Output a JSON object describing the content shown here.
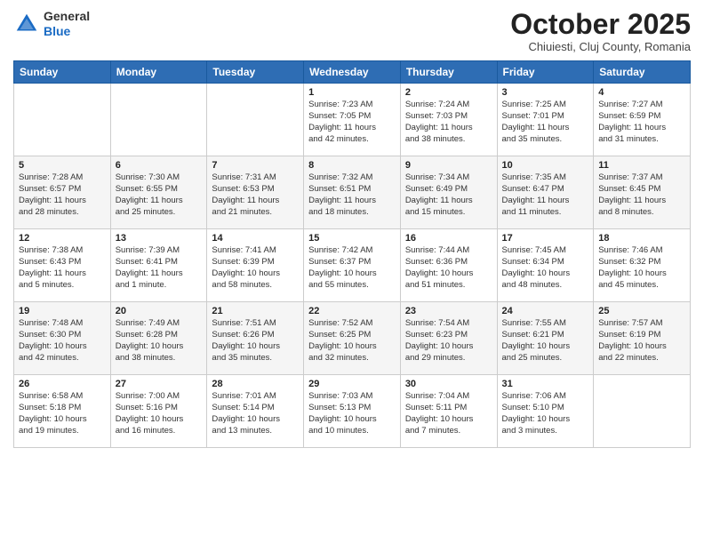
{
  "logo": {
    "general": "General",
    "blue": "Blue"
  },
  "title": "October 2025",
  "subtitle": "Chiuiesti, Cluj County, Romania",
  "days_header": [
    "Sunday",
    "Monday",
    "Tuesday",
    "Wednesday",
    "Thursday",
    "Friday",
    "Saturday"
  ],
  "weeks": [
    [
      {
        "day": "",
        "info": ""
      },
      {
        "day": "",
        "info": ""
      },
      {
        "day": "",
        "info": ""
      },
      {
        "day": "1",
        "info": "Sunrise: 7:23 AM\nSunset: 7:05 PM\nDaylight: 11 hours\nand 42 minutes."
      },
      {
        "day": "2",
        "info": "Sunrise: 7:24 AM\nSunset: 7:03 PM\nDaylight: 11 hours\nand 38 minutes."
      },
      {
        "day": "3",
        "info": "Sunrise: 7:25 AM\nSunset: 7:01 PM\nDaylight: 11 hours\nand 35 minutes."
      },
      {
        "day": "4",
        "info": "Sunrise: 7:27 AM\nSunset: 6:59 PM\nDaylight: 11 hours\nand 31 minutes."
      }
    ],
    [
      {
        "day": "5",
        "info": "Sunrise: 7:28 AM\nSunset: 6:57 PM\nDaylight: 11 hours\nand 28 minutes."
      },
      {
        "day": "6",
        "info": "Sunrise: 7:30 AM\nSunset: 6:55 PM\nDaylight: 11 hours\nand 25 minutes."
      },
      {
        "day": "7",
        "info": "Sunrise: 7:31 AM\nSunset: 6:53 PM\nDaylight: 11 hours\nand 21 minutes."
      },
      {
        "day": "8",
        "info": "Sunrise: 7:32 AM\nSunset: 6:51 PM\nDaylight: 11 hours\nand 18 minutes."
      },
      {
        "day": "9",
        "info": "Sunrise: 7:34 AM\nSunset: 6:49 PM\nDaylight: 11 hours\nand 15 minutes."
      },
      {
        "day": "10",
        "info": "Sunrise: 7:35 AM\nSunset: 6:47 PM\nDaylight: 11 hours\nand 11 minutes."
      },
      {
        "day": "11",
        "info": "Sunrise: 7:37 AM\nSunset: 6:45 PM\nDaylight: 11 hours\nand 8 minutes."
      }
    ],
    [
      {
        "day": "12",
        "info": "Sunrise: 7:38 AM\nSunset: 6:43 PM\nDaylight: 11 hours\nand 5 minutes."
      },
      {
        "day": "13",
        "info": "Sunrise: 7:39 AM\nSunset: 6:41 PM\nDaylight: 11 hours\nand 1 minute."
      },
      {
        "day": "14",
        "info": "Sunrise: 7:41 AM\nSunset: 6:39 PM\nDaylight: 10 hours\nand 58 minutes."
      },
      {
        "day": "15",
        "info": "Sunrise: 7:42 AM\nSunset: 6:37 PM\nDaylight: 10 hours\nand 55 minutes."
      },
      {
        "day": "16",
        "info": "Sunrise: 7:44 AM\nSunset: 6:36 PM\nDaylight: 10 hours\nand 51 minutes."
      },
      {
        "day": "17",
        "info": "Sunrise: 7:45 AM\nSunset: 6:34 PM\nDaylight: 10 hours\nand 48 minutes."
      },
      {
        "day": "18",
        "info": "Sunrise: 7:46 AM\nSunset: 6:32 PM\nDaylight: 10 hours\nand 45 minutes."
      }
    ],
    [
      {
        "day": "19",
        "info": "Sunrise: 7:48 AM\nSunset: 6:30 PM\nDaylight: 10 hours\nand 42 minutes."
      },
      {
        "day": "20",
        "info": "Sunrise: 7:49 AM\nSunset: 6:28 PM\nDaylight: 10 hours\nand 38 minutes."
      },
      {
        "day": "21",
        "info": "Sunrise: 7:51 AM\nSunset: 6:26 PM\nDaylight: 10 hours\nand 35 minutes."
      },
      {
        "day": "22",
        "info": "Sunrise: 7:52 AM\nSunset: 6:25 PM\nDaylight: 10 hours\nand 32 minutes."
      },
      {
        "day": "23",
        "info": "Sunrise: 7:54 AM\nSunset: 6:23 PM\nDaylight: 10 hours\nand 29 minutes."
      },
      {
        "day": "24",
        "info": "Sunrise: 7:55 AM\nSunset: 6:21 PM\nDaylight: 10 hours\nand 25 minutes."
      },
      {
        "day": "25",
        "info": "Sunrise: 7:57 AM\nSunset: 6:19 PM\nDaylight: 10 hours\nand 22 minutes."
      }
    ],
    [
      {
        "day": "26",
        "info": "Sunrise: 6:58 AM\nSunset: 5:18 PM\nDaylight: 10 hours\nand 19 minutes."
      },
      {
        "day": "27",
        "info": "Sunrise: 7:00 AM\nSunset: 5:16 PM\nDaylight: 10 hours\nand 16 minutes."
      },
      {
        "day": "28",
        "info": "Sunrise: 7:01 AM\nSunset: 5:14 PM\nDaylight: 10 hours\nand 13 minutes."
      },
      {
        "day": "29",
        "info": "Sunrise: 7:03 AM\nSunset: 5:13 PM\nDaylight: 10 hours\nand 10 minutes."
      },
      {
        "day": "30",
        "info": "Sunrise: 7:04 AM\nSunset: 5:11 PM\nDaylight: 10 hours\nand 7 minutes."
      },
      {
        "day": "31",
        "info": "Sunrise: 7:06 AM\nSunset: 5:10 PM\nDaylight: 10 hours\nand 3 minutes."
      },
      {
        "day": "",
        "info": ""
      }
    ]
  ]
}
